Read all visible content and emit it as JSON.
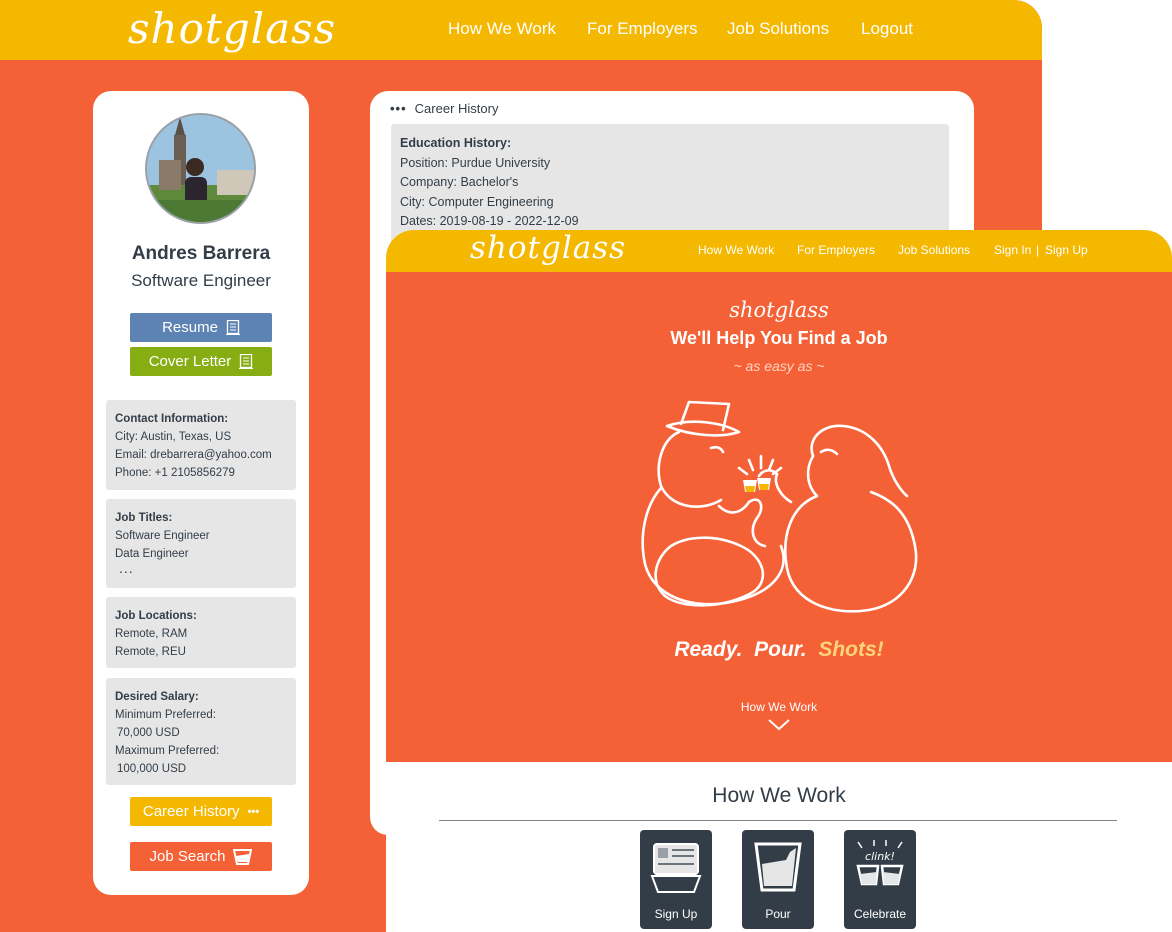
{
  "back_window": {
    "logo": "shotglass",
    "nav": [
      "How We Work",
      "For Employers",
      "Job Solutions",
      "Logout"
    ],
    "profile": {
      "name": "Andres Barrera",
      "title": "Software Engineer",
      "resume_label": "Resume",
      "cover_letter_label": "Cover Letter",
      "contact": {
        "header": "Contact Information:",
        "city": "City: Austin, Texas, US",
        "email": "Email: drebarrera@yahoo.com",
        "phone": "Phone: +1 2105856279"
      },
      "job_titles": {
        "header": "Job Titles:",
        "items": [
          "Software Engineer",
          "Data Engineer"
        ],
        "more": "..."
      },
      "job_locations": {
        "header": "Job Locations:",
        "items": [
          "Remote, RAM",
          "Remote, REU"
        ]
      },
      "salary": {
        "header": "Desired Salary:",
        "min_label": "Minimum Preferred:",
        "min_value": "70,000 USD",
        "max_label": "Maximum Preferred:",
        "max_value": "100,000 USD"
      },
      "career_history_label": "Career History",
      "career_history_icon": "•••",
      "job_search_label": "Job Search"
    },
    "career": {
      "header_icon": "•••",
      "header": "Career History",
      "education_header": "Education History:",
      "position": "Position: Purdue University",
      "company": "Company: Bachelor's",
      "city": "City: Computer Engineering",
      "dates": "Dates: 2019-08-19 - 2022-12-09"
    }
  },
  "front_window": {
    "logo": "shotglass",
    "nav": [
      "How We Work",
      "For Employers",
      "Job Solutions",
      "Sign In",
      "|",
      "Sign Up"
    ],
    "hero": {
      "logo": "shotglass",
      "title": "We'll Help You Find a Job",
      "subtitle": "~ as easy as ~",
      "tag_ready": "Ready.",
      "tag_pour": "Pour.",
      "tag_shots": "Shots!",
      "link": "How We Work"
    },
    "how_we_work": {
      "title": "How We Work",
      "steps": [
        "Sign Up",
        "Pour",
        "Celebrate"
      ],
      "clink_text": "clink!"
    }
  },
  "colors": {
    "orange": "#f46136",
    "yellow": "#f5b800",
    "blue_button": "#5c83b3",
    "green_button": "#86ad12",
    "dark_slate": "#333d47",
    "panel_gray": "#e6e6e6"
  }
}
